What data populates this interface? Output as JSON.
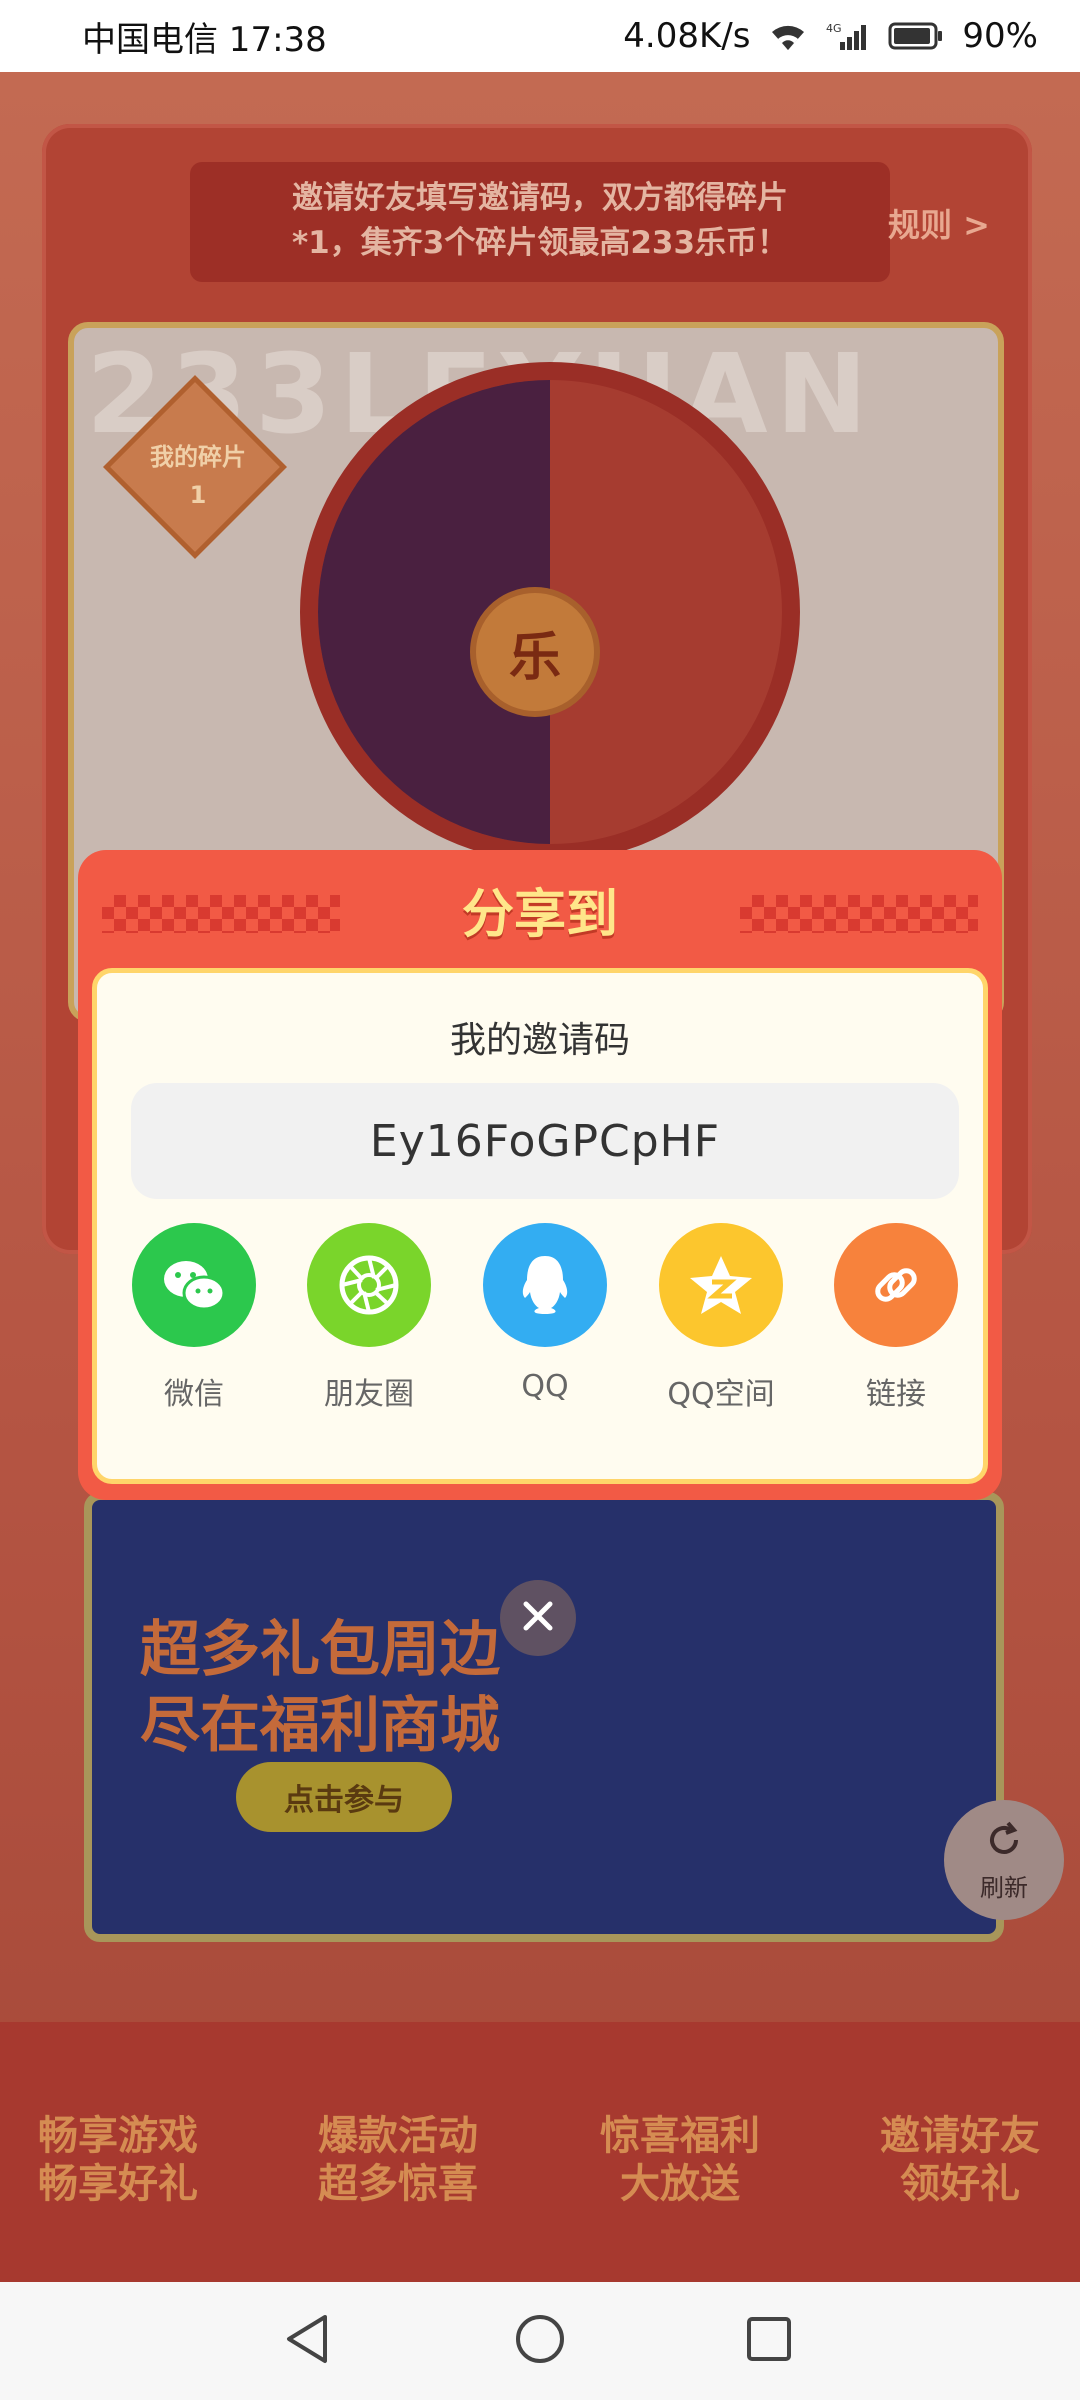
{
  "status_bar": {
    "carrier_time": "中国电信 17:38",
    "net_speed": "4.08K/s",
    "network_type": "4G",
    "battery": "90%"
  },
  "background": {
    "banner_text_line1": "邀请好友填写邀请码，双方都得碎片",
    "banner_text_line2": "*1，集齐3个碎片领最高233乐币！",
    "rules_link": "规则 >",
    "watermark": "233LEYUAN",
    "fragment_label_line1": "我的碎片",
    "fragment_label_line2": "1",
    "wheel_center": "乐",
    "mall_title_line1": "超多礼包周边",
    "mall_title_line2": "尽在福利商城",
    "mall_button": "点击参与",
    "refresh_label": "刷新",
    "features": [
      {
        "line1": "畅享游戏",
        "line2": "畅享好礼"
      },
      {
        "line1": "爆款活动",
        "line2": "超多惊喜"
      },
      {
        "line1": "惊喜福利",
        "line2": "大放送"
      },
      {
        "line1": "邀请好友",
        "line2": "领好礼"
      }
    ]
  },
  "share_modal": {
    "title": "分享到",
    "subtitle": "我的邀请码",
    "invite_code": "Ey16FoGPCpHF",
    "targets": [
      {
        "label": "微信",
        "icon": "wechat-icon",
        "color": "#2cc84d"
      },
      {
        "label": "朋友圈",
        "icon": "moments-icon",
        "color": "#7ad52b"
      },
      {
        "label": "QQ",
        "icon": "qq-icon",
        "color": "#33adf2"
      },
      {
        "label": "QQ空间",
        "icon": "qzone-icon",
        "color": "#fcc62d"
      },
      {
        "label": "链接",
        "icon": "link-icon",
        "color": "#f7823c"
      }
    ]
  },
  "colors": {
    "modal_bg": "#f25a45",
    "modal_title": "#ffe68a",
    "modal_inner_bg": "#fffcf0"
  }
}
